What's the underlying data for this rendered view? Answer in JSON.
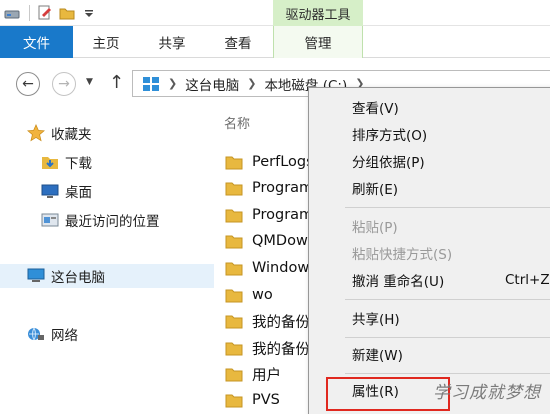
{
  "ribbon": {
    "context_tab": "驱动器工具",
    "tabs": [
      {
        "label": "文件"
      },
      {
        "label": "主页"
      },
      {
        "label": "共享"
      },
      {
        "label": "查看"
      },
      {
        "label": "管理"
      }
    ]
  },
  "address": {
    "crumbs": [
      "这台电脑",
      "本地磁盘 (C:)"
    ]
  },
  "nav": {
    "favorites": "收藏夹",
    "downloads": "下载",
    "desktop": "桌面",
    "recent": "最近访问的位置",
    "this_pc": "这台电脑",
    "network": "网络"
  },
  "content": {
    "column_name": "名称",
    "files": [
      {
        "name": "PerfLogs"
      },
      {
        "name": "Program"
      },
      {
        "name": "Program"
      },
      {
        "name": "QMDow"
      },
      {
        "name": "Window"
      },
      {
        "name": "wo"
      },
      {
        "name": "我的备份"
      },
      {
        "name": "我的备份"
      },
      {
        "name": "用户"
      },
      {
        "name": "PVS"
      }
    ]
  },
  "context_menu": {
    "items": [
      {
        "label": "查看(V)"
      },
      {
        "label": "排序方式(O)"
      },
      {
        "label": "分组依据(P)"
      },
      {
        "label": "刷新(E)"
      },
      {
        "label": "粘贴(P)"
      },
      {
        "label": "粘贴快捷方式(S)"
      },
      {
        "label": "撤消 重命名(U)",
        "shortcut": "Ctrl+Z"
      },
      {
        "label": "共享(H)"
      },
      {
        "label": "新建(W)"
      },
      {
        "label": "属性(R)"
      }
    ]
  },
  "watermark": "学习成就梦想",
  "colors": {
    "file_tab": "#1979ca",
    "context_tab": "#d6efc8",
    "folder": "#e8b83f",
    "highlight_box": "#e0281f"
  }
}
